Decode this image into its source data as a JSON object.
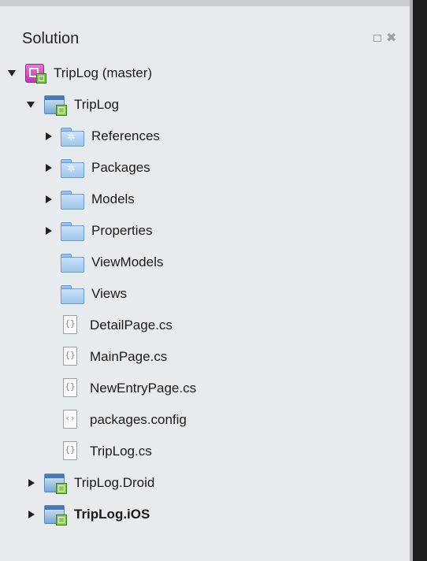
{
  "panel": {
    "title": "Solution",
    "actions": {
      "maximize_icon": "maximize-icon",
      "close_icon": "close-icon",
      "close_glyph": "✖"
    }
  },
  "tree": [
    {
      "label": "TripLog (master)",
      "icon": "solution-icon",
      "arrow": "down"
    },
    {
      "label": "TripLog",
      "icon": "csharp-project-icon",
      "arrow": "down"
    },
    {
      "label": "References",
      "icon": "special-folder-icon",
      "arrow": "right"
    },
    {
      "label": "Packages",
      "icon": "special-folder-icon",
      "arrow": "right"
    },
    {
      "label": "Models",
      "icon": "folder-icon",
      "arrow": "right"
    },
    {
      "label": "Properties",
      "icon": "folder-icon",
      "arrow": "right"
    },
    {
      "label": "ViewModels",
      "icon": "folder-icon",
      "arrow": "none"
    },
    {
      "label": "Views",
      "icon": "folder-icon",
      "arrow": "none"
    },
    {
      "label": "DetailPage.cs",
      "icon": "cs-file-icon",
      "arrow": "none"
    },
    {
      "label": "MainPage.cs",
      "icon": "cs-file-icon",
      "arrow": "none"
    },
    {
      "label": "NewEntryPage.cs",
      "icon": "cs-file-icon",
      "arrow": "none"
    },
    {
      "label": "packages.config",
      "icon": "config-file-icon",
      "arrow": "none"
    },
    {
      "label": "TripLog.cs",
      "icon": "cs-file-icon",
      "arrow": "none"
    },
    {
      "label": "TripLog.Droid",
      "icon": "csharp-project-icon",
      "arrow": "right"
    },
    {
      "label": "TripLog.iOS",
      "icon": "csharp-project-icon",
      "arrow": "right",
      "bold": true
    }
  ],
  "colors": {
    "panel_bg": "#e8ebee",
    "accent_purple": "#b83aa9",
    "accent_green": "#7fc24a",
    "folder_blue": "#9fc6ec"
  }
}
